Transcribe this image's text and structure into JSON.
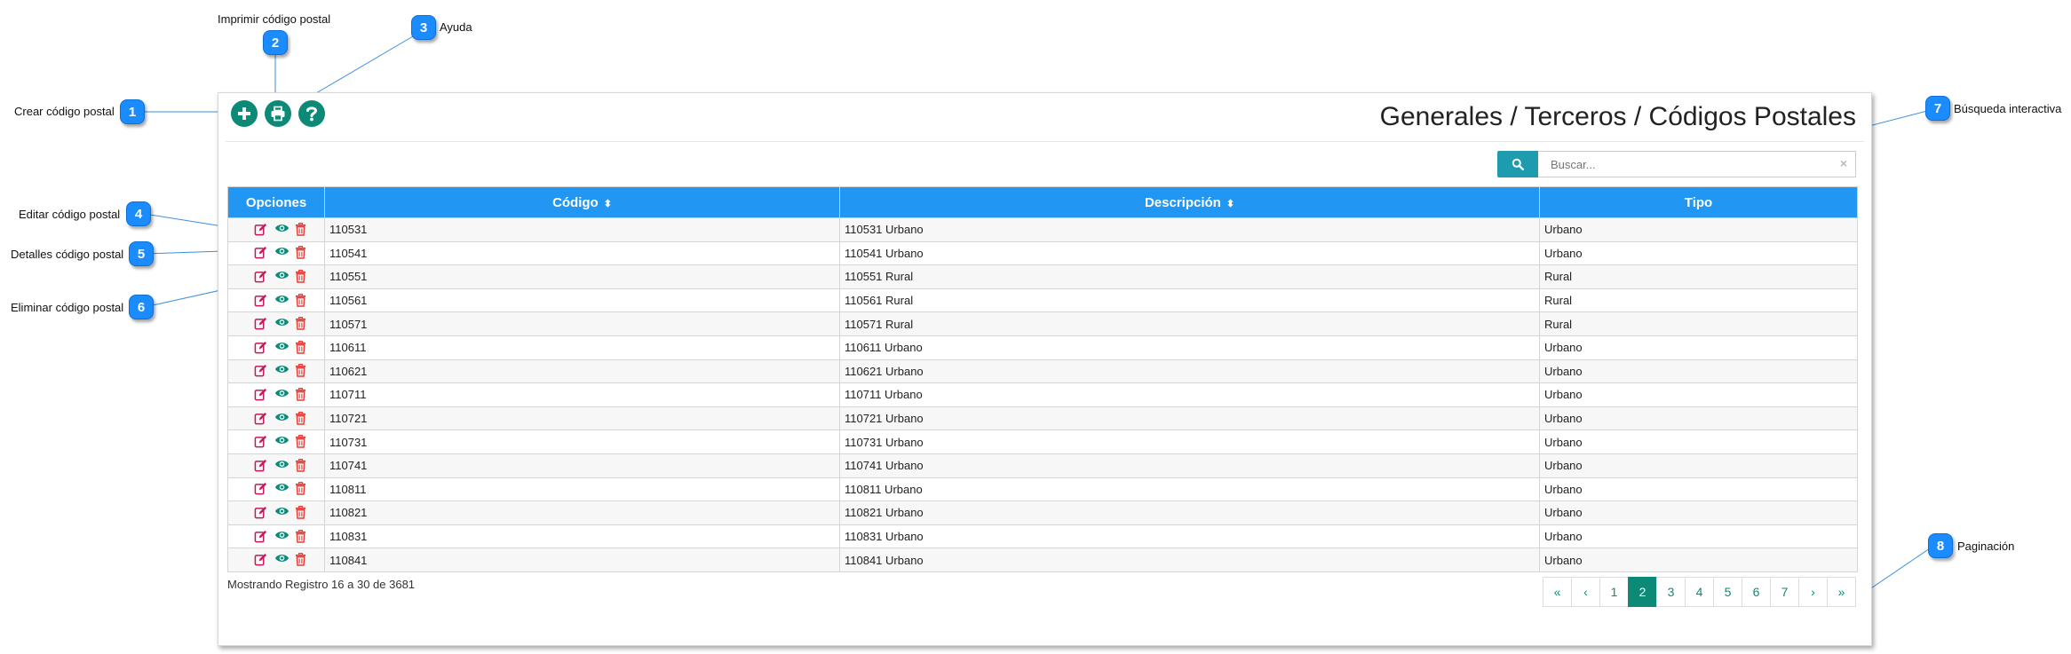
{
  "callouts": [
    {
      "num": "1",
      "label": "Crear código postal"
    },
    {
      "num": "2",
      "label": "Imprimir código postal"
    },
    {
      "num": "3",
      "label": "Ayuda"
    },
    {
      "num": "4",
      "label": "Editar código postal"
    },
    {
      "num": "5",
      "label": "Detalles código postal"
    },
    {
      "num": "6",
      "label": "Eliminar código postal"
    },
    {
      "num": "7",
      "label": "Búsqueda interactiva"
    },
    {
      "num": "8",
      "label": "Paginación"
    }
  ],
  "page": {
    "title": "Generales / Terceros / Códigos Postales"
  },
  "toolbar": {
    "icons": [
      "plus-circle-icon",
      "print-icon",
      "question-circle-icon"
    ]
  },
  "search": {
    "placeholder": "Buscar...",
    "value": "",
    "clear": "×"
  },
  "table": {
    "headers": {
      "options": "Opciones",
      "code": "Código",
      "description": "Descripción",
      "type": "Tipo"
    },
    "sort_icon": "⬍",
    "row_icons": [
      "edit-icon",
      "eye-icon",
      "trash-icon"
    ],
    "rows": [
      {
        "code": "110531",
        "description": "110531 Urbano",
        "type": "Urbano"
      },
      {
        "code": "110541",
        "description": "110541 Urbano",
        "type": "Urbano"
      },
      {
        "code": "110551",
        "description": "110551 Rural",
        "type": "Rural"
      },
      {
        "code": "110561",
        "description": "110561 Rural",
        "type": "Rural"
      },
      {
        "code": "110571",
        "description": "110571 Rural",
        "type": "Rural"
      },
      {
        "code": "110611",
        "description": "110611 Urbano",
        "type": "Urbano"
      },
      {
        "code": "110621",
        "description": "110621 Urbano",
        "type": "Urbano"
      },
      {
        "code": "110711",
        "description": "110711 Urbano",
        "type": "Urbano"
      },
      {
        "code": "110721",
        "description": "110721 Urbano",
        "type": "Urbano"
      },
      {
        "code": "110731",
        "description": "110731 Urbano",
        "type": "Urbano"
      },
      {
        "code": "110741",
        "description": "110741 Urbano",
        "type": "Urbano"
      },
      {
        "code": "110811",
        "description": "110811 Urbano",
        "type": "Urbano"
      },
      {
        "code": "110821",
        "description": "110821 Urbano",
        "type": "Urbano"
      },
      {
        "code": "110831",
        "description": "110831 Urbano",
        "type": "Urbano"
      },
      {
        "code": "110841",
        "description": "110841 Urbano",
        "type": "Urbano"
      }
    ]
  },
  "footer": {
    "summary": "Mostrando Registro 16 a 30 de 3681"
  },
  "pagination": {
    "items": [
      "«",
      "‹",
      "1",
      "2",
      "3",
      "4",
      "5",
      "6",
      "7",
      "›",
      "»"
    ],
    "active": "2"
  },
  "colors": {
    "header_blue": "#2196f3",
    "teal": "#0d8a77",
    "search_button": "#1f9bb0",
    "callout_blue": "#1a8cff",
    "edit_magenta": "#c2185b",
    "delete_red": "#e53935"
  }
}
